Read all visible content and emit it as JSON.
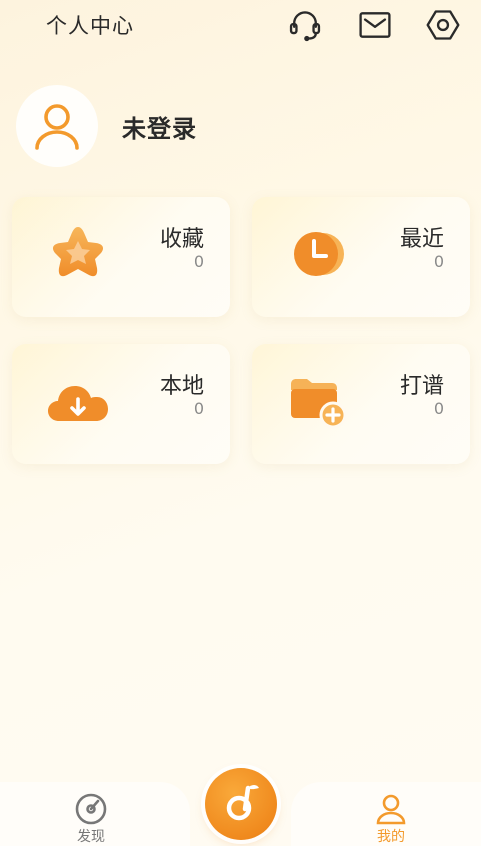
{
  "header": {
    "title": "个人中心",
    "icons": [
      "headset-icon",
      "mail-icon",
      "settings-icon"
    ]
  },
  "profile": {
    "username": "未登录",
    "avatar_icon": "user-icon"
  },
  "cards": [
    {
      "id": "favorites",
      "label": "收藏",
      "count": "0",
      "icon": "star-icon"
    },
    {
      "id": "recent",
      "label": "最近",
      "count": "0",
      "icon": "clock-icon"
    },
    {
      "id": "local",
      "label": "本地",
      "count": "0",
      "icon": "cloud-download-icon"
    },
    {
      "id": "tabs",
      "label": "打谱",
      "count": "0",
      "icon": "folder-add-icon"
    }
  ],
  "bottom_nav": {
    "discover_label": "发现",
    "mine_label": "我的",
    "center_icon": "music-note-icon"
  },
  "colors": {
    "accent": "#f39a2c",
    "accent_dark": "#e57c14",
    "text": "#2a2a2a",
    "muted": "#8a8a8a"
  }
}
